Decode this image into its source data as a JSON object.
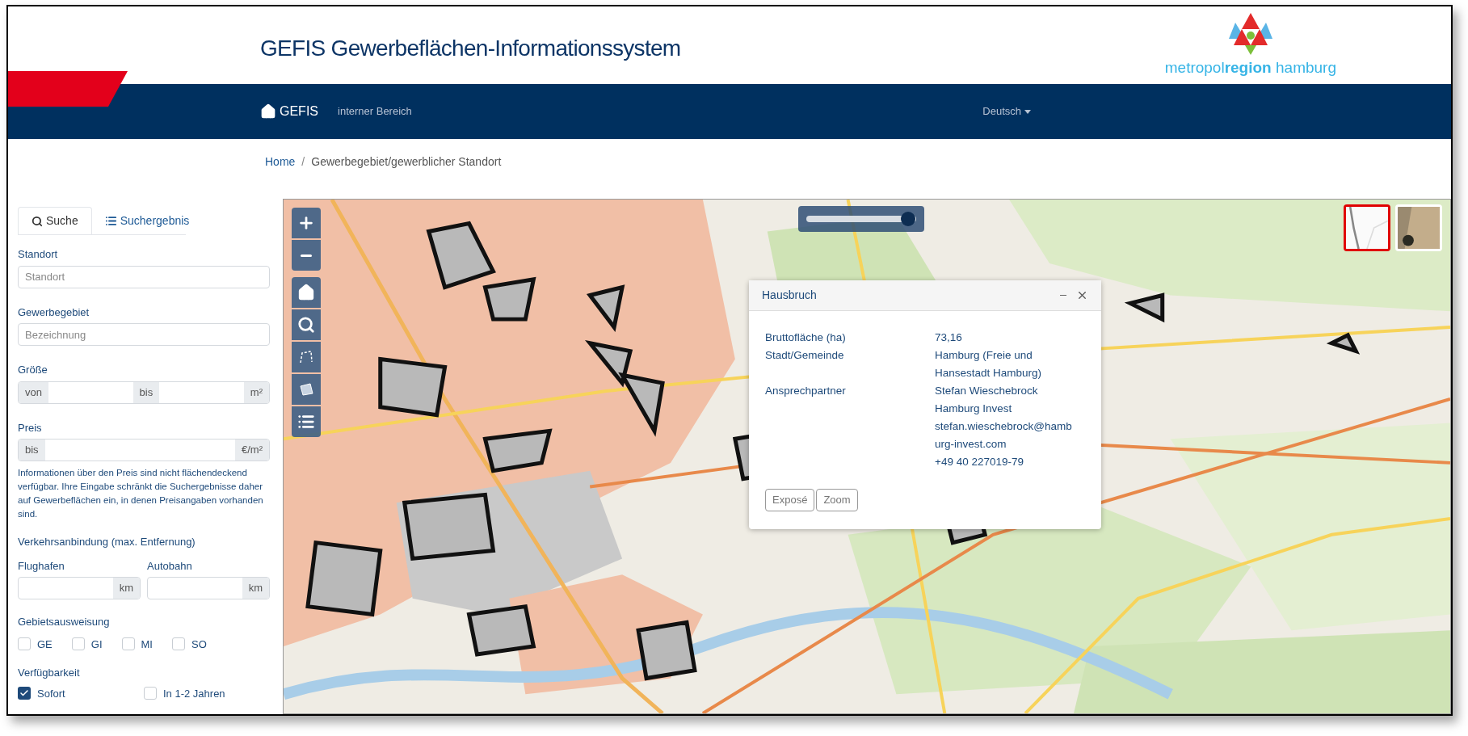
{
  "header": {
    "title": "GEFIS Gewerbeflächen-Informationssystem",
    "logo_text": "metropol**region** hamburg"
  },
  "navbar": {
    "brand": "GEFIS",
    "link": "interner Bereich",
    "language": "Deutsch"
  },
  "breadcrumb": {
    "separator": "/",
    "items": [
      "Home",
      "Gewerbegebiet/gewerblicher Standort"
    ]
  },
  "sidebar": {
    "tabs": [
      {
        "label": "Suche",
        "kind": "search",
        "selected": true
      },
      {
        "label": "Suchergebnis",
        "kind": "list",
        "selected": false
      }
    ],
    "location": {
      "label": "Standort",
      "placeholder": "Standort"
    },
    "area": {
      "label": "Gewerbegebiet",
      "placeholder": "Bezeichnung"
    },
    "size": {
      "label": "Größe",
      "from_addon": "von",
      "to_addon": "bis",
      "unit": "m²"
    },
    "price": {
      "label": "Preis",
      "addon": "bis",
      "unit": "€/m²",
      "note": "Informationen über den Preis sind nicht flächendeckend verfügbar. Ihre Eingabe schränkt die Suchergebnisse daher auf Gewerbeflächen ein, in denen Preisangaben vorhanden sind."
    },
    "transport": {
      "label": "Verkehrsanbindung (max. Entfernung)",
      "fields": [
        {
          "label": "Flughafen",
          "unit": "km"
        },
        {
          "label": "Autobahn",
          "unit": "km"
        }
      ]
    },
    "zoning": {
      "label": "Gebietsausweisung",
      "options": [
        {
          "label": "GE",
          "checked": false
        },
        {
          "label": "GI",
          "checked": false
        },
        {
          "label": "MI",
          "checked": false
        },
        {
          "label": "SO",
          "checked": false
        }
      ]
    },
    "availability": {
      "label": "Verfügbarkeit",
      "options": [
        {
          "label": "Sofort",
          "checked": true
        },
        {
          "label": "In 1-2 Jahren",
          "checked": false
        }
      ]
    }
  },
  "map": {
    "opacity_slider": {
      "level": 0.93
    },
    "basemaps": [
      {
        "kind": "street",
        "selected": true
      },
      {
        "kind": "aerial",
        "selected": false
      }
    ],
    "popup": {
      "title": "Hausbruch",
      "rows": [
        {
          "label": "Bruttofläche (ha)",
          "values": [
            "73,16"
          ]
        },
        {
          "label": "Stadt/Gemeinde",
          "values": [
            "Hamburg (Freie und Hansestadt Hamburg)"
          ]
        },
        {
          "label": "Ansprechpartner",
          "values": [
            "Stefan Wieschebrock",
            "Hamburg Invest",
            "stefan.wieschebrock@hamburg-invest.com",
            "+49 40 227019-79"
          ]
        }
      ],
      "buttons": [
        "Exposé",
        "Zoom"
      ]
    }
  }
}
